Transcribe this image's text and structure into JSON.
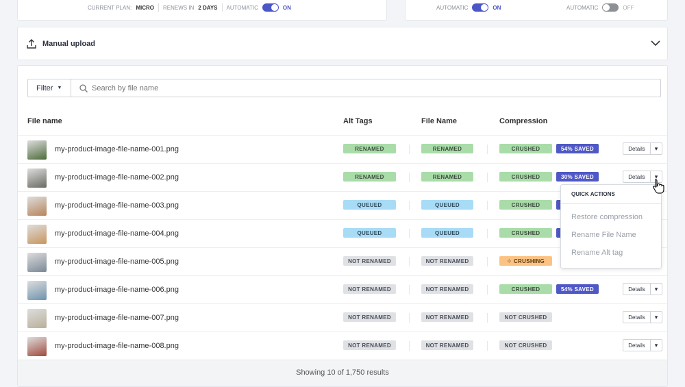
{
  "plan": {
    "current_label": "CURRENT PLAN:",
    "current_value": "MICRO",
    "renews_label": "RENEWS IN",
    "renews_value": "2 DAYS",
    "auto_label": "AUTOMATIC",
    "auto_state": "ON"
  },
  "right_card": {
    "auto1_label": "AUTOMATIC",
    "auto1_state": "ON",
    "auto2_label": "AUTOMATIC",
    "auto2_state": "OFF"
  },
  "upload": {
    "label": "Manual upload"
  },
  "filter": {
    "label": "Filter",
    "search_placeholder": "Search by file name"
  },
  "columns": [
    "File name",
    "Alt Tags",
    "File Name",
    "Compression"
  ],
  "rows": [
    {
      "name": "my-product-image-file-name-001.png",
      "alt": "RENAMED",
      "file": "RENAMED",
      "comp": "CRUSHED",
      "saved": "54% SAVED",
      "thumb": "#4d6b3a",
      "details": true
    },
    {
      "name": "my-product-image-file-name-002.png",
      "alt": "RENAMED",
      "file": "RENAMED",
      "comp": "CRUSHED",
      "saved": "30% SAVED",
      "thumb": "#6b6a62",
      "details": true
    },
    {
      "name": "my-product-image-file-name-003.png",
      "alt": "QUEUED",
      "file": "QUEUED",
      "comp": "CRUSHED",
      "saved": "",
      "thumb": "#b7855a",
      "details": false
    },
    {
      "name": "my-product-image-file-name-004.png",
      "alt": "QUEUED",
      "file": "QUEUED",
      "comp": "CRUSHED",
      "saved": "",
      "thumb": "#c9955e",
      "details": false
    },
    {
      "name": "my-product-image-file-name-005.png",
      "alt": "NOT RENAMED",
      "file": "NOT RENAMED",
      "comp": "CRUSHING",
      "saved": null,
      "thumb": "#7b8896",
      "details": false
    },
    {
      "name": "my-product-image-file-name-006.png",
      "alt": "NOT RENAMED",
      "file": "NOT RENAMED",
      "comp": "CRUSHED",
      "saved": "54% SAVED",
      "thumb": "#6f93ad",
      "details": true
    },
    {
      "name": "my-product-image-file-name-007.png",
      "alt": "NOT RENAMED",
      "file": "NOT RENAMED",
      "comp": "NOT CRUSHED",
      "saved": null,
      "thumb": "#b9b09a",
      "details": true
    },
    {
      "name": "my-product-image-file-name-008.png",
      "alt": "NOT RENAMED",
      "file": "NOT RENAMED",
      "comp": "NOT CRUSHED",
      "saved": null,
      "thumb": "#a0493c",
      "details": true
    }
  ],
  "details_label": "Details",
  "quick_actions": {
    "title": "QUICK ACTIONS",
    "items": [
      "Restore compression",
      "Rename File Name",
      "Rename Alt tag"
    ]
  },
  "footer": "Showing 10 of 1,750 results"
}
